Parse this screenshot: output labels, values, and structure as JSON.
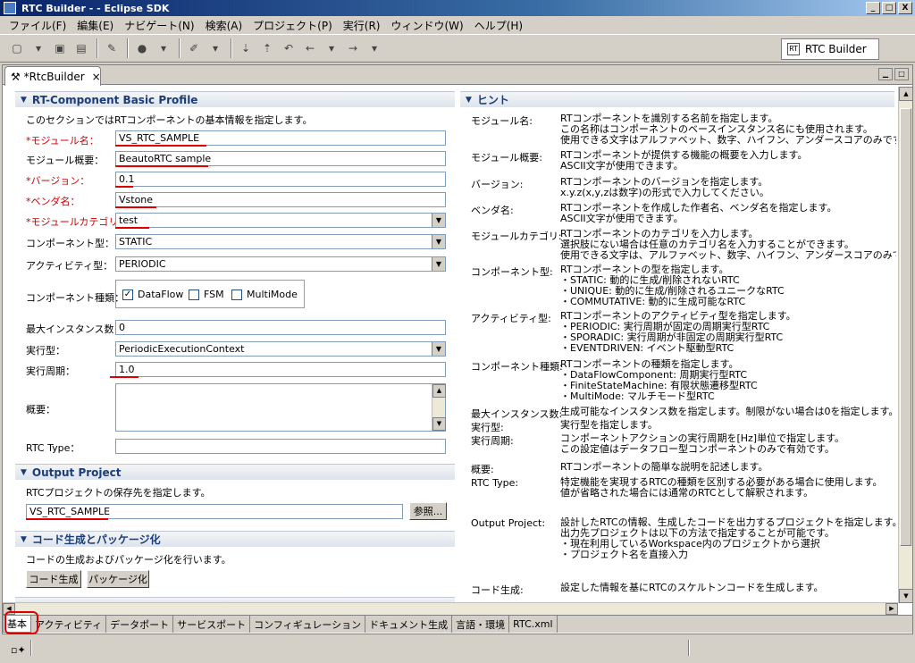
{
  "window": {
    "title": "RTC Builder -  - Eclipse SDK",
    "min": "_",
    "max": "□",
    "close": "X"
  },
  "menu": [
    "ファイル(F)",
    "編集(E)",
    "ナビゲート(N)",
    "検索(A)",
    "プロジェクト(P)",
    "実行(R)",
    "ウィンドウ(W)",
    "ヘルプ(H)"
  ],
  "perspective": {
    "label": "RTC Builder",
    "icon_text": "RT"
  },
  "editor": {
    "tab_label": "*RtcBuilder",
    "close": "×"
  },
  "basic_profile": {
    "title": "RT-Component Basic Profile",
    "description": "このセクションではRTコンポーネントの基本情報を指定します。",
    "module_name_label": "*モジュール名：",
    "module_name": "VS_RTC_SAMPLE",
    "module_desc_label": "モジュール概要：",
    "module_desc": "BeautoRTC sample",
    "version_label": "*バージョン：",
    "version": "0.1",
    "vendor_label": "*ベンダ名：",
    "vendor": "Vstone",
    "category_label": "*モジュールカテゴリ：",
    "category": "test",
    "component_type_label": "コンポーネント型：",
    "component_type": "STATIC",
    "activity_type_label": "アクティビティ型：",
    "activity_type": "PERIODIC",
    "component_kind_label": "コンポーネント種類：",
    "kinds": [
      {
        "label": "DataFlow",
        "checked": true
      },
      {
        "label": "FSM",
        "checked": false
      },
      {
        "label": "MultiMode",
        "checked": false
      }
    ],
    "max_instance_label": "最大インスタンス数：",
    "max_instance": "0",
    "exec_type_label": "実行型：",
    "exec_type": "PeriodicExecutionContext",
    "exec_rate_label": "実行周期：",
    "exec_rate": "1.0",
    "abstract_label": "概要：",
    "rtc_type_label": "RTC Type："
  },
  "output_project": {
    "title": "Output Project",
    "description": "RTCプロジェクトの保存先を指定します。",
    "value": "VS_RTC_SAMPLE",
    "browse": "参照..."
  },
  "codegen": {
    "title": "コード生成とパッケージ化",
    "description": "コードの生成およびパッケージ化を行います。",
    "generate": "コード生成",
    "package": "パッケージ化"
  },
  "hint": {
    "title": "ヒント",
    "items": [
      {
        "key": "モジュール名:",
        "text": "RTコンポーネントを識別する名前を指定します。\nこの名称はコンポーネントのベースインスタンス名にも使用されます。\n使用できる文字はアルファベット、数字、ハイフン、アンダースコアのみです。"
      },
      {
        "key": "モジュール概要:",
        "text": "RTコンポーネントが提供する機能の概要を入力します。\nASCII文字が使用できます。"
      },
      {
        "key": "バージョン:",
        "text": "RTコンポーネントのバージョンを指定します。\nx.y.z(x,y,zは数字)の形式で入力してください。"
      },
      {
        "key": "ベンダ名:",
        "text": "RTコンポーネントを作成した作者名、ベンダ名を指定します。\nASCII文字が使用できます。"
      },
      {
        "key": "モジュールカテゴリ:",
        "text": "RTコンポーネントのカテゴリを入力します。\n選択肢にない場合は任意のカテゴリ名を入力することができます。\n使用できる文字は、アルファベット、数字、ハイフン、アンダースコアのみです。"
      },
      {
        "key": "コンポーネント型:",
        "text": "RTコンポーネントの型を指定します。\n・STATIC: 動的に生成/削除されないRTC\n・UNIQUE: 動的に生成/削除されるユニークなRTC\n・COMMUTATIVE: 動的に生成可能なRTC"
      },
      {
        "key": "アクティビティ型:",
        "text": "RTコンポーネントのアクティビティ型を指定します。\n・PERIODIC: 実行周期が固定の周期実行型RTC\n・SPORADIC: 実行周期が非固定の周期実行型RTC\n・EVENTDRIVEN: イベント駆動型RTC"
      },
      {
        "key": "コンポーネント種類:",
        "text": "RTコンポーネントの種類を指定します。\n・DataFlowComponent: 周期実行型RTC\n・FiniteStateMachine: 有限状態遷移型RTC\n・MultiMode: マルチモード型RTC"
      },
      {
        "key": "最大インスタンス数:",
        "text": "生成可能なインスタンス数を指定します。制限がない場合は0を指定します。"
      },
      {
        "key": "実行型:",
        "text": "実行型を指定します。"
      },
      {
        "key": "実行周期:",
        "text": "コンポーネントアクションの実行周期を[Hz]単位で指定します。\nこの設定値はデータフロー型コンポーネントのみで有効です。"
      },
      {
        "key": "概要:",
        "text": "RTコンポーネントの簡単な説明を記述します。"
      },
      {
        "key": "RTC Type:",
        "text": "特定機能を実現するRTCの種類を区別する必要がある場合に使用します。\n値が省略された場合には通常のRTCとして解釈されます。"
      },
      {
        "key": "Output Project:",
        "text": "設計したRTCの情報、生成したコードを出力するプロジェクトを指定します。\n出力先プロジェクトは以下の方法で指定することが可能です。\n・現在利用しているWorkspace内のプロジェクトから選択\n・プロジェクト名を直接入力"
      },
      {
        "key": "コード生成:",
        "text": "設定した情報を基にRTCのスケルトンコードを生成します。"
      }
    ]
  },
  "bottom_tabs": [
    "基本",
    "アクティビティ",
    "データポート",
    "サービスポート",
    "コンフィギュレーション",
    "ドキュメント生成",
    "言語・環境",
    "RTC.xml"
  ],
  "highlight_color": "#e00000"
}
